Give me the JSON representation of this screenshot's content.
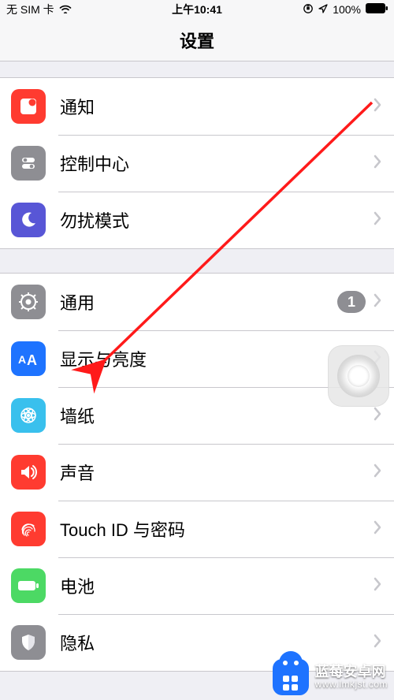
{
  "status": {
    "carrier": "无 SIM 卡",
    "time": "上午10:41",
    "battery": "100%"
  },
  "header": {
    "title": "设置"
  },
  "groups": {
    "g1": {
      "notify": {
        "label": "通知"
      },
      "control": {
        "label": "控制中心"
      },
      "dnd": {
        "label": "勿扰模式"
      }
    },
    "g2": {
      "general": {
        "label": "通用",
        "badge": "1"
      },
      "display": {
        "label": "显示与亮度"
      },
      "wall": {
        "label": "墙纸"
      },
      "sound": {
        "label": "声音"
      },
      "touchid": {
        "label": "Touch ID 与密码"
      },
      "battery": {
        "label": "电池"
      },
      "privacy": {
        "label": "隐私"
      }
    }
  },
  "watermark": {
    "title": "蓝莓安卓网",
    "url": "www.lmkjst.com"
  }
}
